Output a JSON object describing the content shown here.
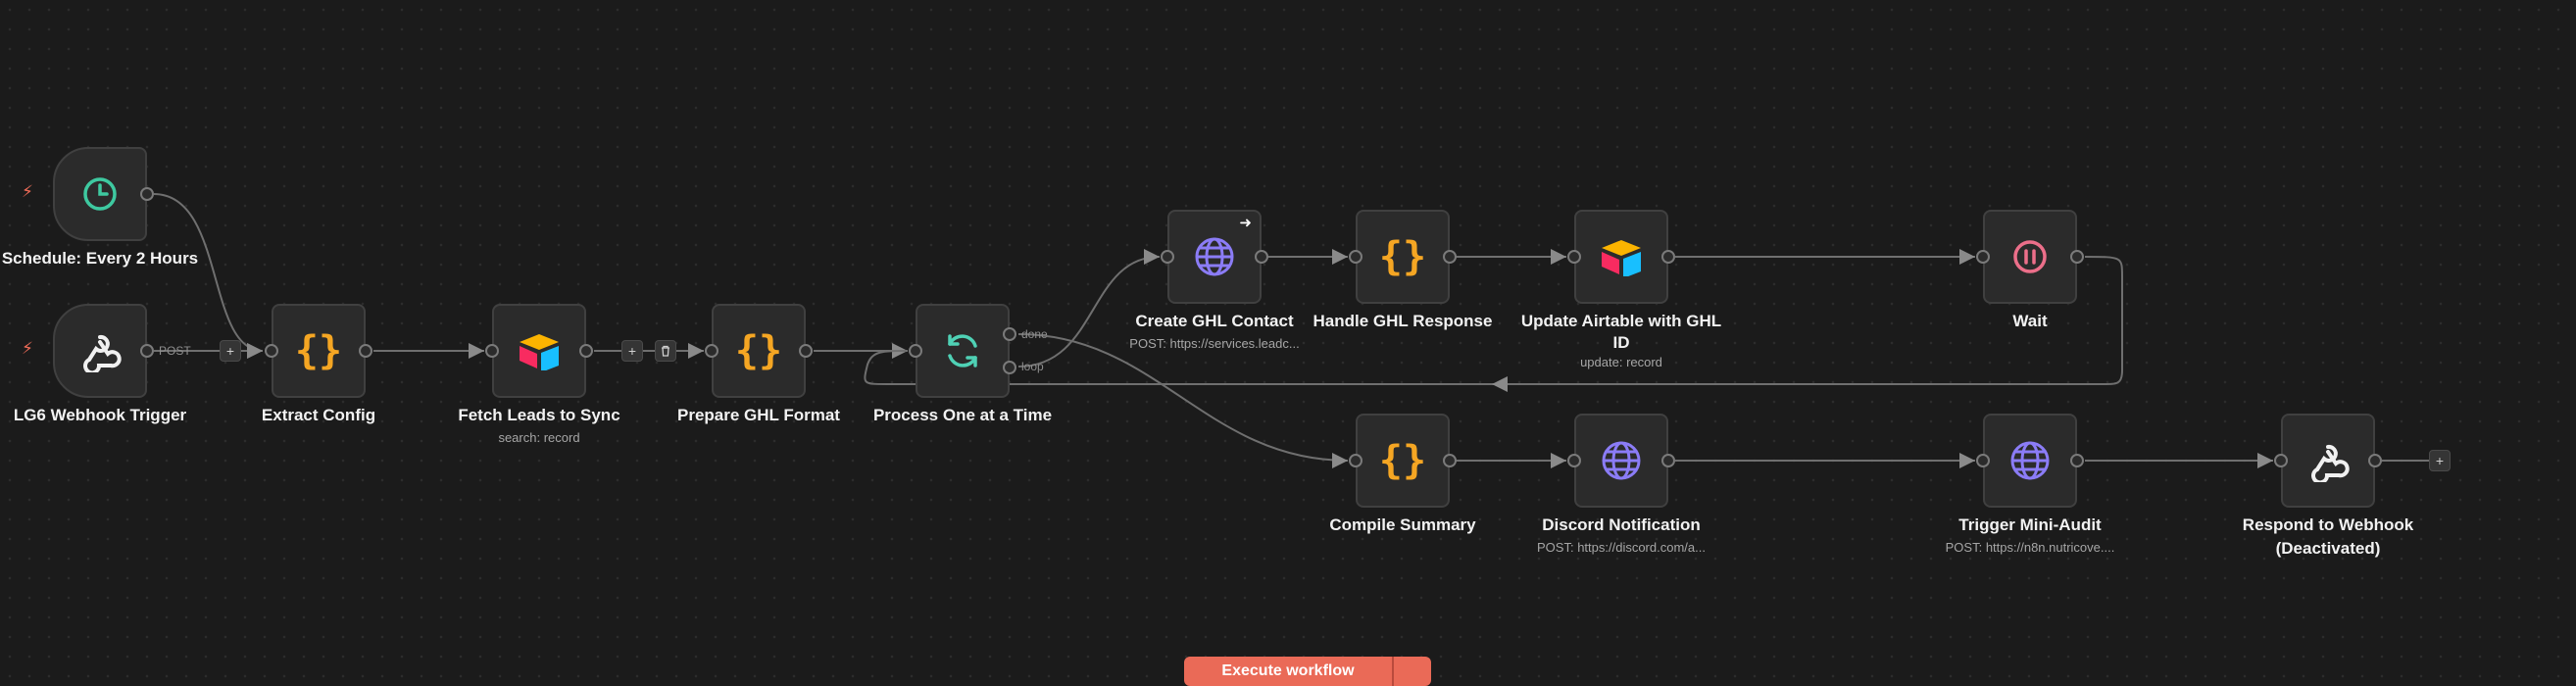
{
  "nodes": {
    "schedule": {
      "name": "Schedule: Every 2 Hours"
    },
    "webhook": {
      "name": "LG6 Webhook Trigger"
    },
    "extract_config": {
      "name": "Extract Config"
    },
    "fetch_leads": {
      "name": "Fetch Leads to Sync",
      "subtitle": "search: record"
    },
    "prepare_ghl": {
      "name": "Prepare GHL Format"
    },
    "process_one": {
      "name": "Process One at a Time"
    },
    "create_ghl": {
      "name": "Create GHL Contact",
      "subtitle": "POST: https://services.leadc..."
    },
    "handle_ghl": {
      "name": "Handle GHL Response"
    },
    "update_airtable": {
      "name_line1": "Update Airtable with GHL",
      "name_line2": "ID",
      "subtitle": "update: record"
    },
    "wait": {
      "name": "Wait"
    },
    "compile_summary": {
      "name": "Compile Summary"
    },
    "discord": {
      "name": "Discord Notification",
      "subtitle": "POST: https://discord.com/a..."
    },
    "trigger_mini_audit": {
      "name": "Trigger Mini-Audit",
      "subtitle": "POST: https://n8n.nutricove...."
    },
    "respond_webhook": {
      "name_line1": "Respond to Webhook",
      "name_line2": "(Deactivated)"
    }
  },
  "edges": {
    "post_label": "POST",
    "done_label": "done",
    "loop_label": "loop"
  },
  "toolbar": {
    "execute_label": "Execute workflow"
  },
  "colors": {
    "background": "#1b1b1b",
    "node_bg": "#2b2b2b",
    "accent": "#ea6a57",
    "code_icon": "#f5a623",
    "http_icon": "#8b7cf6",
    "loop_icon": "#4fd1b5",
    "wait_icon": "#ec6f8a",
    "schedule_icon": "#3ec9a0"
  }
}
